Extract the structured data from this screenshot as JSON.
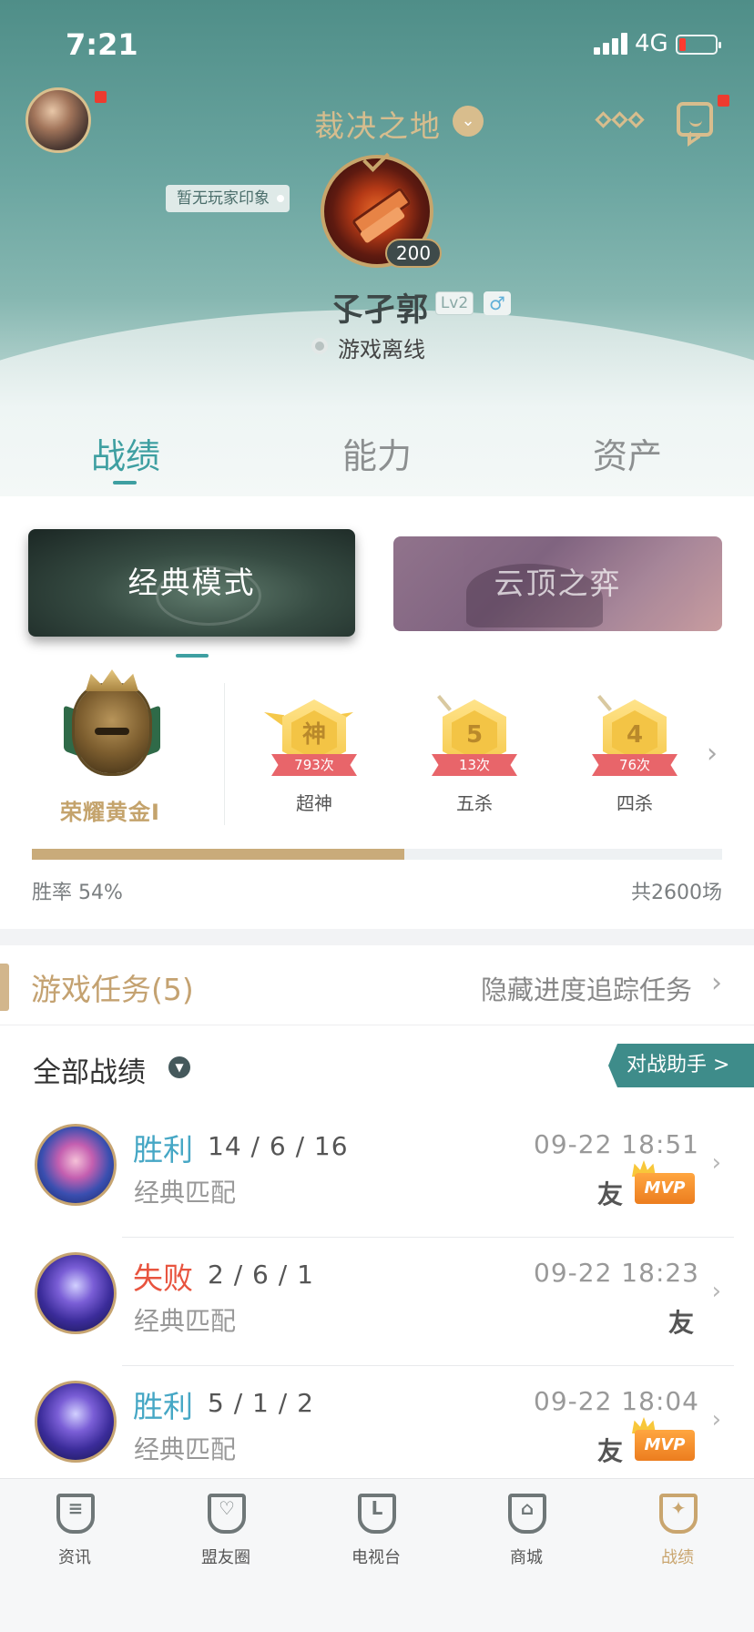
{
  "status_bar": {
    "time": "7:21",
    "network": "4G"
  },
  "header": {
    "server": "裁决之地",
    "impression": "暂无玩家印象",
    "hero_level": "200",
    "name": "孓孑郭",
    "level_badge": "Lv2",
    "gender": "♂",
    "status": "游戏离线"
  },
  "tabs": [
    "战绩",
    "能力",
    "资产"
  ],
  "modes": {
    "classic": "经典模式",
    "tft": "云顶之弈"
  },
  "rank": {
    "name": "荣耀黄金I"
  },
  "achievements": [
    {
      "glyph": "神",
      "count": "793次",
      "label": "超神"
    },
    {
      "glyph": "5",
      "count": "13次",
      "label": "五杀"
    },
    {
      "glyph": "4",
      "count": "76次",
      "label": "四杀"
    }
  ],
  "stats": {
    "win_rate_label": "胜率 54%",
    "win_rate": 0.54,
    "total_label": "共2600场"
  },
  "quests": {
    "title": "游戏任务(5)",
    "hide": "隐藏进度追踪任务"
  },
  "matches_header": {
    "title": "全部战绩",
    "assistant": "对战助手 >"
  },
  "matches": [
    {
      "result": "胜利",
      "kda": "14 / 6 / 16",
      "mode": "经典匹配",
      "time": "09-22 18:51",
      "friend": "友",
      "mvp": "MVP"
    },
    {
      "result": "失败",
      "kda": "2 / 6 / 1",
      "mode": "经典匹配",
      "time": "09-22 18:23",
      "friend": "友"
    },
    {
      "result": "胜利",
      "kda": "5 / 1 / 2",
      "mode": "经典匹配",
      "time": "09-22 18:04",
      "friend": "友",
      "mvp": "MVP"
    }
  ],
  "bottom_nav": [
    {
      "label": "资讯",
      "glyph": "≡"
    },
    {
      "label": "盟友圈",
      "glyph": "♡"
    },
    {
      "label": "电视台",
      "glyph": "L"
    },
    {
      "label": "商城",
      "glyph": "⌂"
    },
    {
      "label": "战绩",
      "glyph": "✦"
    }
  ],
  "colors": {
    "accent": "#3e9fa1",
    "gold": "#c9a56e",
    "win": "#46a7c5",
    "loss": "#e8543f"
  }
}
